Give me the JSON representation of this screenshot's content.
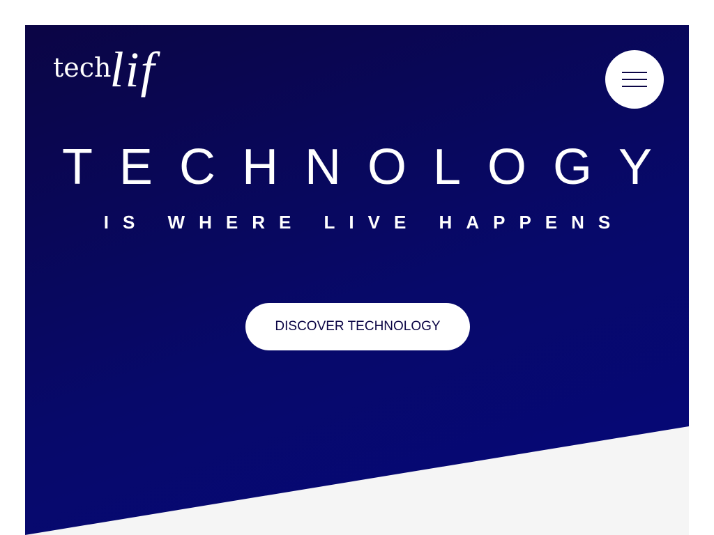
{
  "logo": {
    "part1": "tech",
    "part2": "lif"
  },
  "header": {
    "menu_icon": "hamburger-menu-icon"
  },
  "hero": {
    "title": "TECHNOLOGY",
    "subtitle": "IS WHERE LIVE HAPPENS",
    "cta_label": "DISCOVER TECHNOLOGY"
  },
  "colors": {
    "hero_dark": "#0b0545",
    "hero_blue": "#06087a",
    "section_bg": "#f5f5f5",
    "text_light": "#ffffff"
  }
}
